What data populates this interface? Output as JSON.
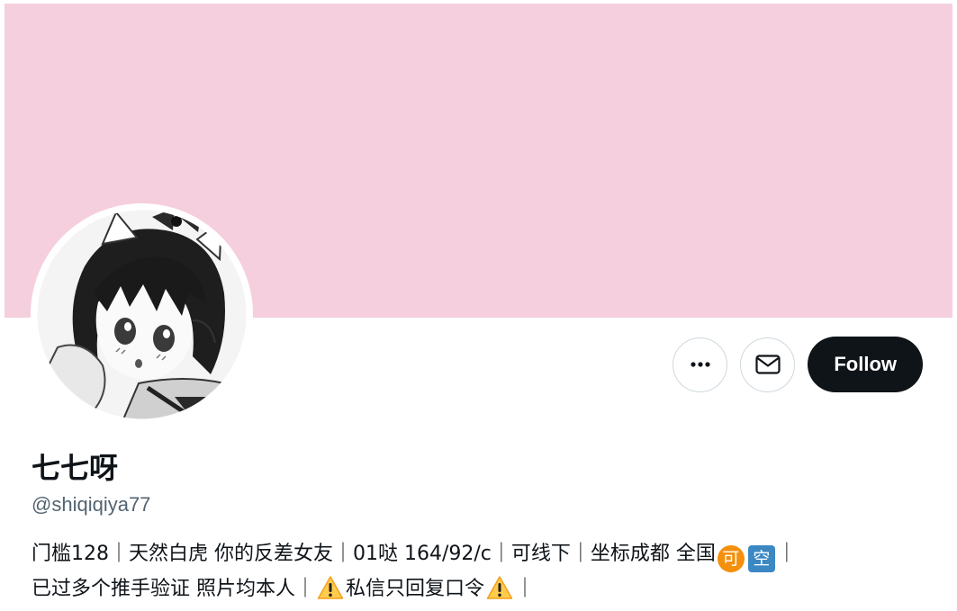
{
  "profile": {
    "display_name": "七七呀",
    "handle": "@shiqiqiya77",
    "banner_color": "#f5cfdd"
  },
  "actions": {
    "more_icon": "more-horizontal-icon",
    "message_icon": "envelope-icon",
    "follow_label": "Follow"
  },
  "bio": {
    "line1_a": "门槛128｜天然白虎 你的反差女友｜01哒 164/92/c｜可线下｜坐标成都 全国",
    "emoji_ke": "可",
    "emoji_kong": "空",
    "line1_b": "｜",
    "line2_a": "已过多个推手验证 照片均本人｜",
    "warning_icon": "warning-icon",
    "line2_b": "私信只回复口令",
    "line2_c": "｜"
  }
}
